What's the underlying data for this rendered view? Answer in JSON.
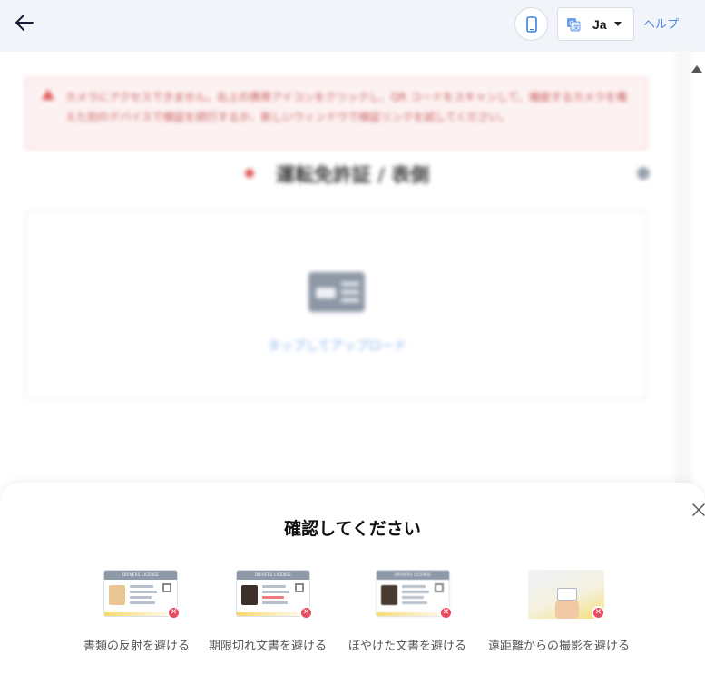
{
  "header": {
    "back_icon": "arrow-left-icon",
    "phone_icon": "smartphone-icon",
    "translate_icon": "translate-icon",
    "language": "Ja",
    "help": "ヘルプ",
    "colors": {
      "background": "#f1f4f9",
      "link": "#4a86e8"
    }
  },
  "alert": {
    "icon": "warning-icon",
    "text": "カメラにアクセスできません。右上の携帯アイコンをクリックし、QR コードをスキャンして、機能するカメラを備えた別のデバイスで検証を続行するか、新しいウィンドウで検証リンクを試してください。",
    "color": "#c85a5a"
  },
  "document": {
    "title": "運転免許証 / 表側",
    "upload_text": "タップしてアップロード",
    "upload_icon": "id-card-icon"
  },
  "sheet": {
    "close_icon": "close-icon",
    "title": "確認してください",
    "card_header": "DRIVERS LICENSE",
    "tips": [
      {
        "label": "書類の反射を避ける",
        "icon": "glare-card-icon"
      },
      {
        "label": "期限切れ文書を避ける",
        "icon": "expired-card-icon"
      },
      {
        "label": "ぼやけた文書を避ける",
        "icon": "blurry-card-icon"
      },
      {
        "label": "遠距離からの撮影を避ける",
        "icon": "far-distance-icon"
      }
    ],
    "badge_color": "#e84a5f"
  }
}
